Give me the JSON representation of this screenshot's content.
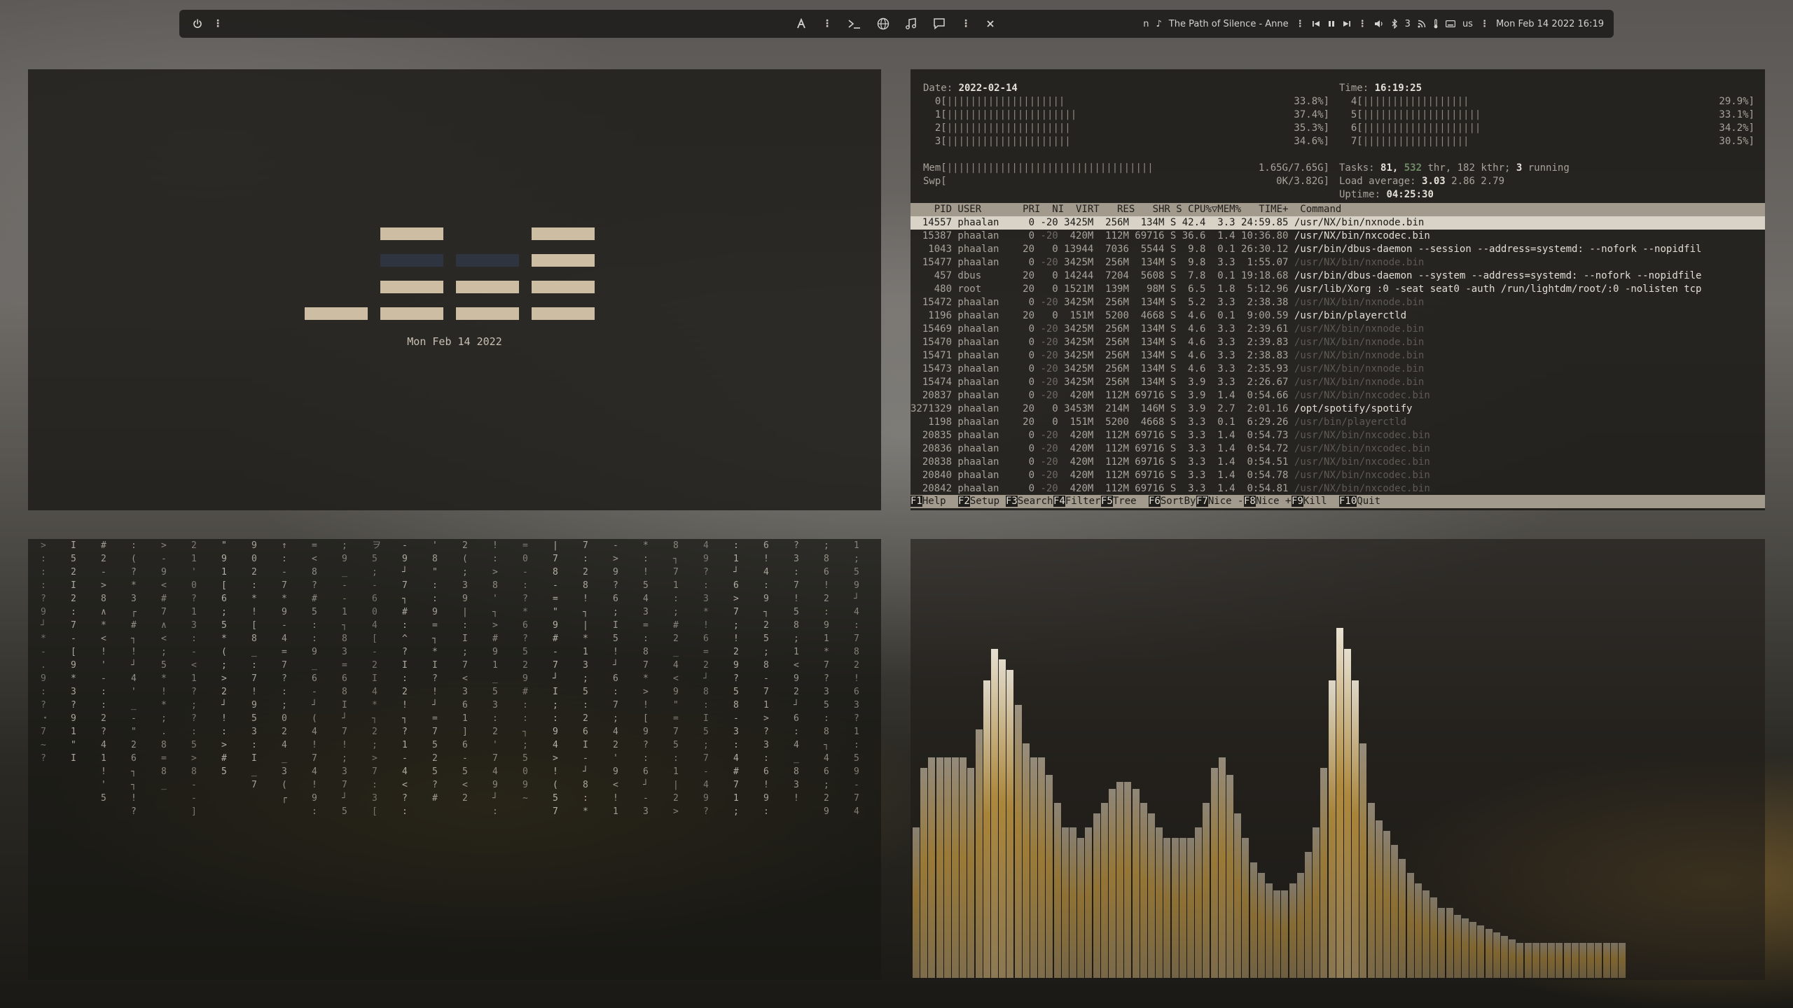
{
  "topbar": {
    "center_icons": [
      "text-cursor-icon",
      "terminal-icon",
      "globe-icon",
      "music-note-icon",
      "chat-bubble-icon"
    ],
    "now_playing_prefix": "n",
    "now_playing": "The Path of Silence - Anne",
    "volume_value": "3",
    "keyboard_layout": "us",
    "datetime": "Mon Feb 14 2022 16:19"
  },
  "clock": {
    "date": "Mon Feb 14 2022",
    "on_color": "#cdbda2",
    "off_color": "#2f3540",
    "grid": [
      [
        0,
        0,
        0,
        0
      ],
      [
        0,
        1,
        0,
        1
      ],
      [
        0,
        2,
        0,
        1
      ],
      [
        0,
        1,
        1,
        1
      ],
      [
        1,
        1,
        1,
        1
      ]
    ]
  },
  "htop": {
    "date_label": "Date: ",
    "date": "2022-02-14",
    "time_label": "Time: ",
    "time": "16:19:25",
    "cpus": [
      {
        "id": "0",
        "bar": "||||||||||||||||||||",
        "pct": "33.8%"
      },
      {
        "id": "1",
        "bar": "||||||||||||||||||||||",
        "pct": "37.4%"
      },
      {
        "id": "2",
        "bar": "|||||||||||||||||||||",
        "pct": "35.3%"
      },
      {
        "id": "3",
        "bar": "|||||||||||||||||||||",
        "pct": "34.6%"
      },
      {
        "id": "4",
        "bar": "||||||||||||||||||",
        "pct": "29.9%"
      },
      {
        "id": "5",
        "bar": "||||||||||||||||||||",
        "pct": "33.1%"
      },
      {
        "id": "6",
        "bar": "||||||||||||||||||||",
        "pct": "34.2%"
      },
      {
        "id": "7",
        "bar": "||||||||||||||||||",
        "pct": "30.5%"
      }
    ],
    "mem_label": "Mem[",
    "mem_bar": "|||||||||||||||||||||||||||||||||||",
    "mem_value": "1.65G/7.65G]",
    "swp_label": "Swp[",
    "swp_value": "0K/3.82G]",
    "tasks_label": "Tasks: ",
    "tasks": "81, ",
    "thr": "532",
    "thr_suffix": " thr, 182 kthr; ",
    "running": "3",
    "running_suffix": " running",
    "load_label": "Load average: ",
    "load1": "3.03",
    "load_rest": " 2.86 2.79",
    "uptime_label": "Uptime: ",
    "uptime": "04:25:30",
    "header": "    PID USER       PRI  NI  VIRT   RES   SHR S CPU%▽MEM%   TIME+  Command",
    "rows": [
      {
        "pid": "14557",
        "user": "phaalan",
        "pri": "0",
        "ni": "-20",
        "virt": "3425M",
        "res": "256M",
        "shr": "134M",
        "s": "S",
        "cpu": "42.4",
        "mem": "3.3",
        "time": "24:59.85",
        "cmd": "/usr/NX/bin/nxnode.bin",
        "dim": false,
        "sel": true
      },
      {
        "pid": "15387",
        "user": "phaalan",
        "pri": "0",
        "ni": "-20",
        "virt": "420M",
        "res": "112M",
        "shr": "69716",
        "s": "S",
        "cpu": "36.6",
        "mem": "1.4",
        "time": "10:36.80",
        "cmd": "/usr/NX/bin/nxcodec.bin",
        "dim": false,
        "sel": false
      },
      {
        "pid": "1043",
        "user": "phaalan",
        "pri": "20",
        "ni": "0",
        "virt": "13944",
        "res": "7036",
        "shr": "5544",
        "s": "S",
        "cpu": "9.8",
        "mem": "0.1",
        "time": "26:30.12",
        "cmd": "/usr/bin/dbus-daemon --session --address=systemd: --nofork --nopidfil",
        "dim": false,
        "sel": false
      },
      {
        "pid": "15477",
        "user": "phaalan",
        "pri": "0",
        "ni": "-20",
        "virt": "3425M",
        "res": "256M",
        "shr": "134M",
        "s": "S",
        "cpu": "9.8",
        "mem": "3.3",
        "time": "1:55.07",
        "cmd": "/usr/NX/bin/nxnode.bin",
        "dim": true,
        "sel": false
      },
      {
        "pid": "457",
        "user": "dbus",
        "pri": "20",
        "ni": "0",
        "virt": "14244",
        "res": "7204",
        "shr": "5608",
        "s": "S",
        "cpu": "7.8",
        "mem": "0.1",
        "time": "19:18.68",
        "cmd": "/usr/bin/dbus-daemon --system --address=systemd: --nofork --nopidfile",
        "dim": false,
        "sel": false
      },
      {
        "pid": "480",
        "user": "root",
        "pri": "20",
        "ni": "0",
        "virt": "1521M",
        "res": "139M",
        "shr": "98M",
        "s": "S",
        "cpu": "6.5",
        "mem": "1.8",
        "time": "5:12.96",
        "cmd": "/usr/lib/Xorg :0 -seat seat0 -auth /run/lightdm/root/:0 -nolisten tcp",
        "dim": false,
        "sel": false
      },
      {
        "pid": "15472",
        "user": "phaalan",
        "pri": "0",
        "ni": "-20",
        "virt": "3425M",
        "res": "256M",
        "shr": "134M",
        "s": "S",
        "cpu": "5.2",
        "mem": "3.3",
        "time": "2:38.38",
        "cmd": "/usr/NX/bin/nxnode.bin",
        "dim": true,
        "sel": false
      },
      {
        "pid": "1196",
        "user": "phaalan",
        "pri": "20",
        "ni": "0",
        "virt": "151M",
        "res": "5200",
        "shr": "4668",
        "s": "S",
        "cpu": "4.6",
        "mem": "0.1",
        "time": "9:00.59",
        "cmd": "/usr/bin/playerctld",
        "dim": false,
        "sel": false
      },
      {
        "pid": "15469",
        "user": "phaalan",
        "pri": "0",
        "ni": "-20",
        "virt": "3425M",
        "res": "256M",
        "shr": "134M",
        "s": "S",
        "cpu": "4.6",
        "mem": "3.3",
        "time": "2:39.61",
        "cmd": "/usr/NX/bin/nxnode.bin",
        "dim": true,
        "sel": false
      },
      {
        "pid": "15470",
        "user": "phaalan",
        "pri": "0",
        "ni": "-20",
        "virt": "3425M",
        "res": "256M",
        "shr": "134M",
        "s": "S",
        "cpu": "4.6",
        "mem": "3.3",
        "time": "2:39.83",
        "cmd": "/usr/NX/bin/nxnode.bin",
        "dim": true,
        "sel": false
      },
      {
        "pid": "15471",
        "user": "phaalan",
        "pri": "0",
        "ni": "-20",
        "virt": "3425M",
        "res": "256M",
        "shr": "134M",
        "s": "S",
        "cpu": "4.6",
        "mem": "3.3",
        "time": "2:38.83",
        "cmd": "/usr/NX/bin/nxnode.bin",
        "dim": true,
        "sel": false
      },
      {
        "pid": "15473",
        "user": "phaalan",
        "pri": "0",
        "ni": "-20",
        "virt": "3425M",
        "res": "256M",
        "shr": "134M",
        "s": "S",
        "cpu": "4.6",
        "mem": "3.3",
        "time": "2:35.93",
        "cmd": "/usr/NX/bin/nxnode.bin",
        "dim": true,
        "sel": false
      },
      {
        "pid": "15474",
        "user": "phaalan",
        "pri": "0",
        "ni": "-20",
        "virt": "3425M",
        "res": "256M",
        "shr": "134M",
        "s": "S",
        "cpu": "3.9",
        "mem": "3.3",
        "time": "2:26.67",
        "cmd": "/usr/NX/bin/nxnode.bin",
        "dim": true,
        "sel": false
      },
      {
        "pid": "20837",
        "user": "phaalan",
        "pri": "0",
        "ni": "-20",
        "virt": "420M",
        "res": "112M",
        "shr": "69716",
        "s": "S",
        "cpu": "3.9",
        "mem": "1.4",
        "time": "0:54.66",
        "cmd": "/usr/NX/bin/nxcodec.bin",
        "dim": true,
        "sel": false
      },
      {
        "pid": "3271329",
        "user": "phaalan",
        "pri": "20",
        "ni": "0",
        "virt": "3453M",
        "res": "214M",
        "shr": "146M",
        "s": "S",
        "cpu": "3.9",
        "mem": "2.7",
        "time": "2:01.16",
        "cmd": "/opt/spotify/spotify",
        "dim": false,
        "sel": false
      },
      {
        "pid": "1198",
        "user": "phaalan",
        "pri": "20",
        "ni": "0",
        "virt": "151M",
        "res": "5200",
        "shr": "4668",
        "s": "S",
        "cpu": "3.3",
        "mem": "0.1",
        "time": "6:29.26",
        "cmd": "/usr/bin/playerctld",
        "dim": true,
        "sel": false
      },
      {
        "pid": "20835",
        "user": "phaalan",
        "pri": "0",
        "ni": "-20",
        "virt": "420M",
        "res": "112M",
        "shr": "69716",
        "s": "S",
        "cpu": "3.3",
        "mem": "1.4",
        "time": "0:54.73",
        "cmd": "/usr/NX/bin/nxcodec.bin",
        "dim": true,
        "sel": false
      },
      {
        "pid": "20836",
        "user": "phaalan",
        "pri": "0",
        "ni": "-20",
        "virt": "420M",
        "res": "112M",
        "shr": "69716",
        "s": "S",
        "cpu": "3.3",
        "mem": "1.4",
        "time": "0:54.72",
        "cmd": "/usr/NX/bin/nxcodec.bin",
        "dim": true,
        "sel": false
      },
      {
        "pid": "20838",
        "user": "phaalan",
        "pri": "0",
        "ni": "-20",
        "virt": "420M",
        "res": "112M",
        "shr": "69716",
        "s": "S",
        "cpu": "3.3",
        "mem": "1.4",
        "time": "0:54.51",
        "cmd": "/usr/NX/bin/nxcodec.bin",
        "dim": true,
        "sel": false
      },
      {
        "pid": "20840",
        "user": "phaalan",
        "pri": "0",
        "ni": "-20",
        "virt": "420M",
        "res": "112M",
        "shr": "69716",
        "s": "S",
        "cpu": "3.3",
        "mem": "1.4",
        "time": "0:54.78",
        "cmd": "/usr/NX/bin/nxcodec.bin",
        "dim": true,
        "sel": false
      },
      {
        "pid": "20842",
        "user": "phaalan",
        "pri": "0",
        "ni": "-20",
        "virt": "420M",
        "res": "112M",
        "shr": "69716",
        "s": "S",
        "cpu": "3.3",
        "mem": "1.4",
        "time": "0:54.81",
        "cmd": "/usr/NX/bin/nxcodec.bin",
        "dim": true,
        "sel": false
      }
    ],
    "footer": [
      {
        "key": "F1",
        "label": "Help"
      },
      {
        "key": "F2",
        "label": "Setup"
      },
      {
        "key": "F3",
        "label": "Search"
      },
      {
        "key": "F4",
        "label": "Filter"
      },
      {
        "key": "F5",
        "label": "Tree"
      },
      {
        "key": "F6",
        "label": "SortBy"
      },
      {
        "key": "F7",
        "label": "Nice -"
      },
      {
        "key": "F8",
        "label": "Nice +"
      },
      {
        "key": "F9",
        "label": "Kill"
      },
      {
        "key": "F10",
        "label": "Quit"
      }
    ]
  },
  "matrix": {
    "columns": [
      ">  :  :  : ?  9 ┘ * -  .  9 : ? ・ 7 ~ ?",
      "I  5  2  I  2  :  7  -  [  9  *  3  ?  9  1  \"  I",
      "# 2 - > 8 ∧ * < ! ' - : : 2 ? 4  1 ! ' 5",
      ": ( ? * 3 ┌ # ┐ ! ┘ 4 ' _ - \" 2 6 ┐ ┐ ! ?",
      "> - 9 <  #  7 ∧  < ; 5 * ! * ; . 8 = 8 _",
      "2 1 ' 0 ? 1 3 : - < 1 ? ; ? : 5 > 8 - - ]",
      "\" 9 1 [ 6 ; 5 * ( ; > 2 ┘ ! : > # 5",
      "9 0 2 : * ! [ 8 _ : 7 ! 9 5 3 : I _ 7",
      "↑ : - 7 * 9 - 4 = 7 ? : ; 0 2 4 _ 3 ( ┌",
      "= < 8 ? # 5 : : 9 _ 6 - ┘ ( 4 ! 7 4 ! 9 :",
      "; 9 _ - - 1 ┐ 8 3 = 6 8 I ┘ 7 ! ; 3 7 ┘ 5",
      "ヲ 5 ; - 6 0 4 [ - 2 I 4 * ┐ 2 ; > 7 : 3 [",
      "- 9 ┘ 7 ┐ # : ^ ? I : 2 ! ┐ ? 1 - 4 < ? :",
      "' 8 \" : : 9 = ┐ * I ? ! ┘ = 7 5 2 5 ? #",
      "2 ( ; 3 9 | : I ; 7 < 3 6 1 ] 6 - 5 < 2",
      "! : > 8 ' ┐ > # 9 1 _ 5 3 : 2 ' 7 4 9 ┘ :",
      "= 0 - : ? * 6 ? 5 2 9 # : : ┐ ; 5 0 9 ~",
      "| 7 8 - = \" 9 # - 7 ┘ I ; : 9 4 > ! ( 5 7",
      "7 : 2 8 ! ┐ | * 1 3 ; 5 : 2 6 I - ┘ 8 : *",
      "- > 9 ? 6 ; I 5 ! ┘ 6 : 7 ; 4 2 ' 9 < ! 1",
      "* : ! 5 4 3 = : 8 7 * > ! [ 9 ? : 6 ┘ - 3",
      "8 ┐ 7 1 : ; # 2 _ 4 < 9 \" = 7 5 : 1 | 2 >",
      "4 9 ? : 3 * ! 6 = 2 ┘ 8 : I 5 ; 7 - 4 9 ?",
      ": 1 ┘ 6 > 7 ; ! 2 9 ? 5 8 - 3 : 4 # 7 1 ;",
      "6 ! 4 : 9 ┐ 2 5 ; 8 - 7 1 > ? 3 : 6 ! 9 :",
      "? 3 : 7 ! 5 8 ; 1 < 9 2 ┘ 6 : 4 _ 8 3 !",
      "; 8 6 ! 2 : 9 1 * 7 ? 3 5 : 8 ┐ 4 6 ; 2 9",
      "1 ; 5 9 ┘ 4 : 7 8 2 ! 6 3 ? 1 : 5 9 - 7 4"
    ]
  },
  "visualizer": {
    "bars": [
      0.43,
      0.6,
      0.63,
      0.63,
      0.63,
      0.63,
      0.63,
      0.6,
      0.71,
      0.85,
      0.94,
      0.91,
      0.88,
      0.78,
      0.67,
      0.63,
      0.63,
      0.58,
      0.5,
      0.43,
      0.43,
      0.4,
      0.43,
      0.47,
      0.5,
      0.54,
      0.56,
      0.56,
      0.54,
      0.5,
      0.47,
      0.43,
      0.4,
      0.4,
      0.4,
      0.4,
      0.43,
      0.5,
      0.6,
      0.63,
      0.58,
      0.47,
      0.4,
      0.33,
      0.3,
      0.27,
      0.25,
      0.25,
      0.27,
      0.3,
      0.36,
      0.43,
      0.6,
      0.85,
      1.0,
      0.94,
      0.85,
      0.67,
      0.5,
      0.45,
      0.42,
      0.38,
      0.34,
      0.3,
      0.27,
      0.25,
      0.23,
      0.2,
      0.2,
      0.18,
      0.17,
      0.16,
      0.15,
      0.14,
      0.13,
      0.12,
      0.11,
      0.1,
      0.1,
      0.1,
      0.1,
      0.1,
      0.1,
      0.1,
      0.1,
      0.1,
      0.1,
      0.1,
      0.1,
      0.1,
      0.1
    ],
    "peak_color": "#e9e2d2",
    "gold_color": "#b08a3c"
  }
}
